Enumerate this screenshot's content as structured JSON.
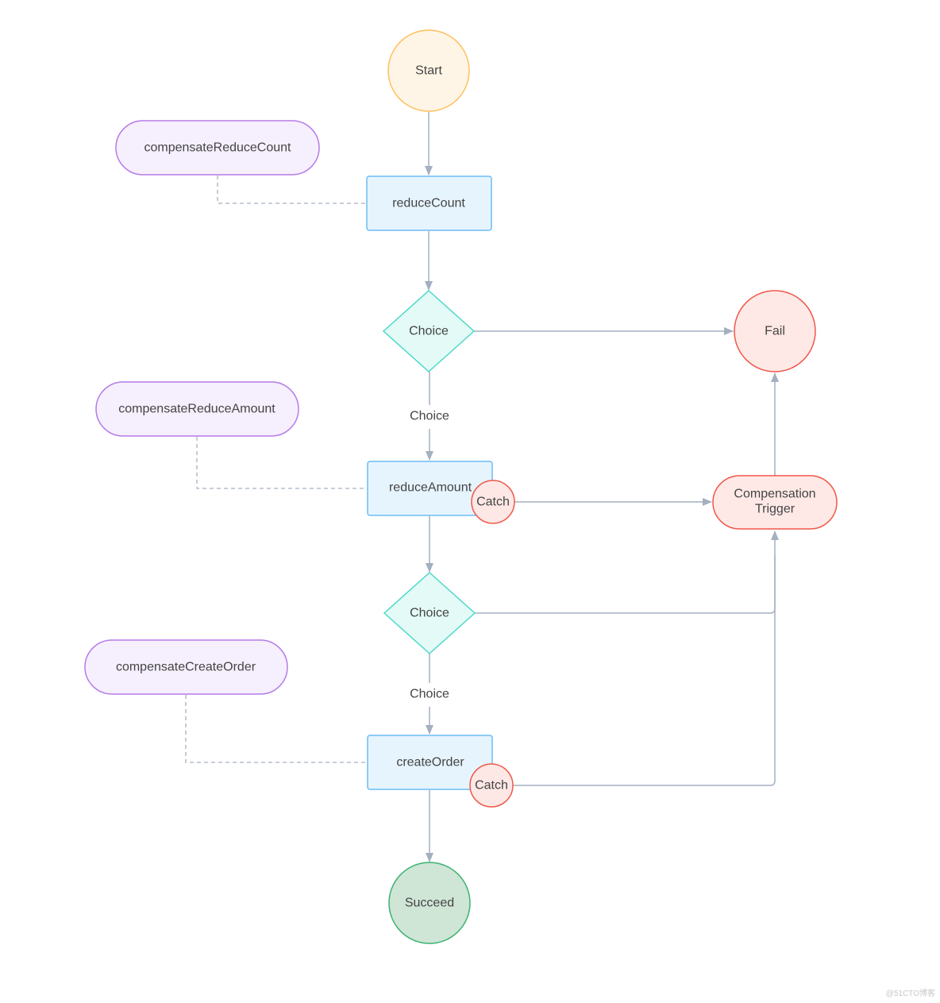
{
  "nodes": {
    "start": "Start",
    "reduce_count": "reduceCount",
    "choice1": "Choice",
    "fail": "Fail",
    "reduce_amount": "reduceAmount",
    "catch1": "Catch",
    "compensation_trigger_line1": "Compensation",
    "compensation_trigger_line2": "Trigger",
    "choice2": "Choice",
    "create_order": "createOrder",
    "catch2": "Catch",
    "succeed": "Succeed",
    "compensate_reduce_count": "compensateReduceCount",
    "compensate_reduce_amount": "compensateReduceAmount",
    "compensate_create_order": "compensateCreateOrder"
  },
  "edge_labels": {
    "choice1_to_reduce_amount": "Choice",
    "choice2_to_create_order": "Choice"
  },
  "colors": {
    "start": "#fff5e6",
    "fail": "#ffe9e6",
    "succeed": "#cfe5d6",
    "task": "#e6f4fe",
    "choice": "#e3faf6",
    "compensation": "#f6effd",
    "edge": "#a4b0c0"
  },
  "watermark": "@51CTO博客"
}
